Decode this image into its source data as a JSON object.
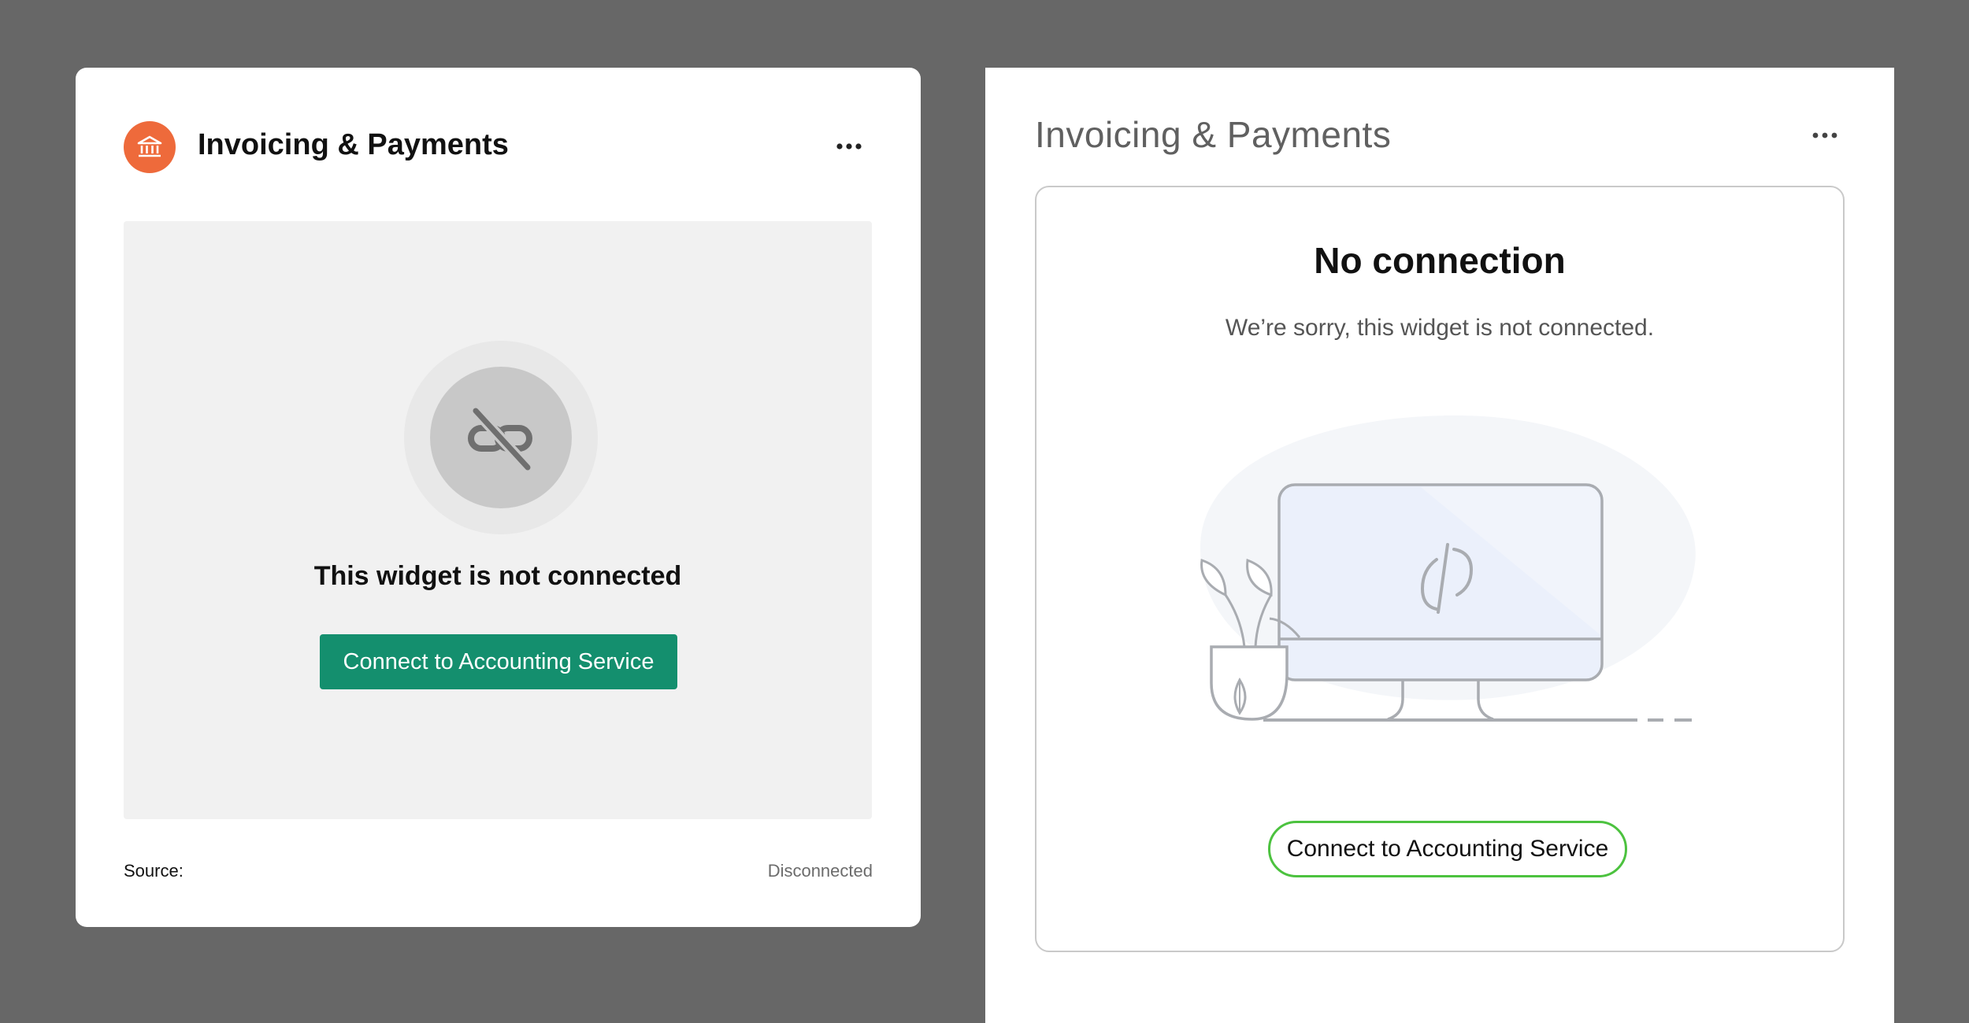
{
  "left_widget": {
    "title": "Invoicing & Payments",
    "icon": "bank-icon",
    "menu_icon": "more-horizontal-icon",
    "message": "This widget is not connected",
    "status_icon": "unlink-icon",
    "button_label": "Connect to Accounting Service",
    "footer": {
      "source_label": "Source:",
      "status": "Disconnected"
    }
  },
  "right_widget": {
    "title": "Invoicing & Payments",
    "menu_icon": "more-horizontal-icon",
    "heading": "No connection",
    "subtext": "We’re sorry, this widget is not connected.",
    "illustration": "disconnected-monitor-illustration",
    "button_label": "Connect to Accounting Service"
  },
  "colors": {
    "background": "#676767",
    "badge_orange": "#ee6a3b",
    "button_green": "#148f6e",
    "outline_green": "#4cc23f"
  }
}
